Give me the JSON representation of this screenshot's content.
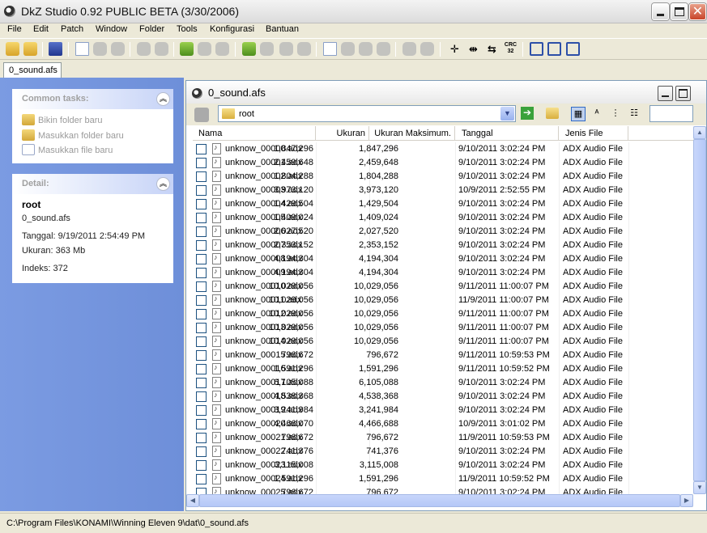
{
  "window": {
    "title": "DkZ Studio 0.92 PUBLIC BETA (3/30/2006)",
    "accent_color": "#6e8fd9"
  },
  "menu": {
    "items": [
      {
        "label": "File"
      },
      {
        "label": "Edit"
      },
      {
        "label": "Patch"
      },
      {
        "label": "Window"
      },
      {
        "label": "Folder"
      },
      {
        "label": "Tools"
      },
      {
        "label": "Konfigurasi"
      },
      {
        "label": "Bantuan"
      }
    ]
  },
  "toolbar": {
    "crc_label": "CRC\n32"
  },
  "doc_tab": {
    "label": "0_sound.afs"
  },
  "sidebar": {
    "tasks": {
      "heading": "Common tasks:",
      "items": [
        {
          "label": "Bikin folder baru",
          "icon": "folder-new-icon"
        },
        {
          "label": "Masukkan folder baru",
          "icon": "folder-import-icon"
        },
        {
          "label": "Masukkan file baru",
          "icon": "file-import-icon"
        }
      ]
    },
    "detail": {
      "heading": "Detail:",
      "name": "root",
      "file": "0_sound.afs",
      "date": "Tanggal: 9/19/2011 2:54:49 PM",
      "size": "Ukuran: 363 Mb",
      "index": "Indeks: 372"
    }
  },
  "explorer": {
    "title": "0_sound.afs",
    "path_value": "root",
    "columns": {
      "name": "Nama",
      "size": "Ukuran",
      "max_size": "Ukuran Maksimum.",
      "date": "Tanggal",
      "type": "Jenis File"
    },
    "rows": [
      {
        "name": "unknow_00000.adx",
        "size": "1,847,296",
        "max": "1,847,296",
        "date": "9/10/2011 3:02:24 PM",
        "type": "ADX Audio File"
      },
      {
        "name": "unknow_00001.adx",
        "size": "2,459,648",
        "max": "2,459,648",
        "date": "9/10/2011 3:02:24 PM",
        "type": "ADX Audio File"
      },
      {
        "name": "unknow_00002.adx",
        "size": "1,804,288",
        "max": "1,804,288",
        "date": "9/10/2011 3:02:24 PM",
        "type": "ADX Audio File"
      },
      {
        "name": "unknow_00003.adx",
        "size": "3,973,120",
        "max": "3,973,120",
        "date": "10/9/2011 2:52:55 PM",
        "type": "ADX Audio File"
      },
      {
        "name": "unknow_00004.adx",
        "size": "1,429,504",
        "max": "1,429,504",
        "date": "9/10/2011 3:02:24 PM",
        "type": "ADX Audio File"
      },
      {
        "name": "unknow_00005.adx",
        "size": "1,409,024",
        "max": "1,409,024",
        "date": "9/10/2011 3:02:24 PM",
        "type": "ADX Audio File"
      },
      {
        "name": "unknow_00006.adx",
        "size": "2,027,520",
        "max": "2,027,520",
        "date": "9/10/2011 3:02:24 PM",
        "type": "ADX Audio File"
      },
      {
        "name": "unknow_00007.adx",
        "size": "2,353,152",
        "max": "2,353,152",
        "date": "9/10/2011 3:02:24 PM",
        "type": "ADX Audio File"
      },
      {
        "name": "unknow_00008.adx",
        "size": "4,194,304",
        "max": "4,194,304",
        "date": "9/10/2011 3:02:24 PM",
        "type": "ADX Audio File"
      },
      {
        "name": "unknow_00009.adx",
        "size": "4,194,304",
        "max": "4,194,304",
        "date": "9/10/2011 3:02:24 PM",
        "type": "ADX Audio File"
      },
      {
        "name": "unknow_00010.adx",
        "size": "10,029,056",
        "max": "10,029,056",
        "date": "9/11/2011 11:00:07 PM",
        "type": "ADX Audio File"
      },
      {
        "name": "unknow_00011.adx",
        "size": "10,029,056",
        "max": "10,029,056",
        "date": "11/9/2011 11:00:07 PM",
        "type": "ADX Audio File"
      },
      {
        "name": "unknow_00012.adx",
        "size": "10,029,056",
        "max": "10,029,056",
        "date": "9/11/2011 11:00:07 PM",
        "type": "ADX Audio File"
      },
      {
        "name": "unknow_00013.adx",
        "size": "10,029,056",
        "max": "10,029,056",
        "date": "9/11/2011 11:00:07 PM",
        "type": "ADX Audio File"
      },
      {
        "name": "unknow_00014.adx",
        "size": "10,029,056",
        "max": "10,029,056",
        "date": "9/11/2011 11:00:07 PM",
        "type": "ADX Audio File"
      },
      {
        "name": "unknow_00015.adx",
        "size": "796,672",
        "max": "796,672",
        "date": "9/11/2011 10:59:53 PM",
        "type": "ADX Audio File"
      },
      {
        "name": "unknow_00016.adx",
        "size": "1,591,296",
        "max": "1,591,296",
        "date": "9/11/2011 10:59:52 PM",
        "type": "ADX Audio File"
      },
      {
        "name": "unknow_00017.adx",
        "size": "6,105,088",
        "max": "6,105,088",
        "date": "9/10/2011 3:02:24 PM",
        "type": "ADX Audio File"
      },
      {
        "name": "unknow_00018.adx",
        "size": "4,538,368",
        "max": "4,538,368",
        "date": "9/10/2011 3:02:24 PM",
        "type": "ADX Audio File"
      },
      {
        "name": "unknow_00019.adx",
        "size": "3,241,984",
        "max": "3,241,984",
        "date": "9/10/2011 3:02:24 PM",
        "type": "ADX Audio File"
      },
      {
        "name": "unknow_00020.adx",
        "size": "4,466,070",
        "max": "4,466,688",
        "date": "10/9/2011 3:01:02 PM",
        "type": "ADX Audio File"
      },
      {
        "name": "unknow_00021.adx",
        "size": "796,672",
        "max": "796,672",
        "date": "11/9/2011 10:59:53 PM",
        "type": "ADX Audio File"
      },
      {
        "name": "unknow_00022.adx",
        "size": "741,376",
        "max": "741,376",
        "date": "9/10/2011 3:02:24 PM",
        "type": "ADX Audio File"
      },
      {
        "name": "unknow_00023.adx",
        "size": "3,115,008",
        "max": "3,115,008",
        "date": "9/10/2011 3:02:24 PM",
        "type": "ADX Audio File"
      },
      {
        "name": "unknow_00024.adx",
        "size": "1,591,296",
        "max": "1,591,296",
        "date": "11/9/2011 10:59:52 PM",
        "type": "ADX Audio File"
      },
      {
        "name": "unknow_00025.adx",
        "size": "796,672",
        "max": "796,672",
        "date": "9/10/2011 3:02:24 PM",
        "type": "ADX Audio File"
      }
    ]
  },
  "status": {
    "path": "C:\\Program Files\\KONAMI\\Winning Eleven 9\\dat\\0_sound.afs"
  }
}
